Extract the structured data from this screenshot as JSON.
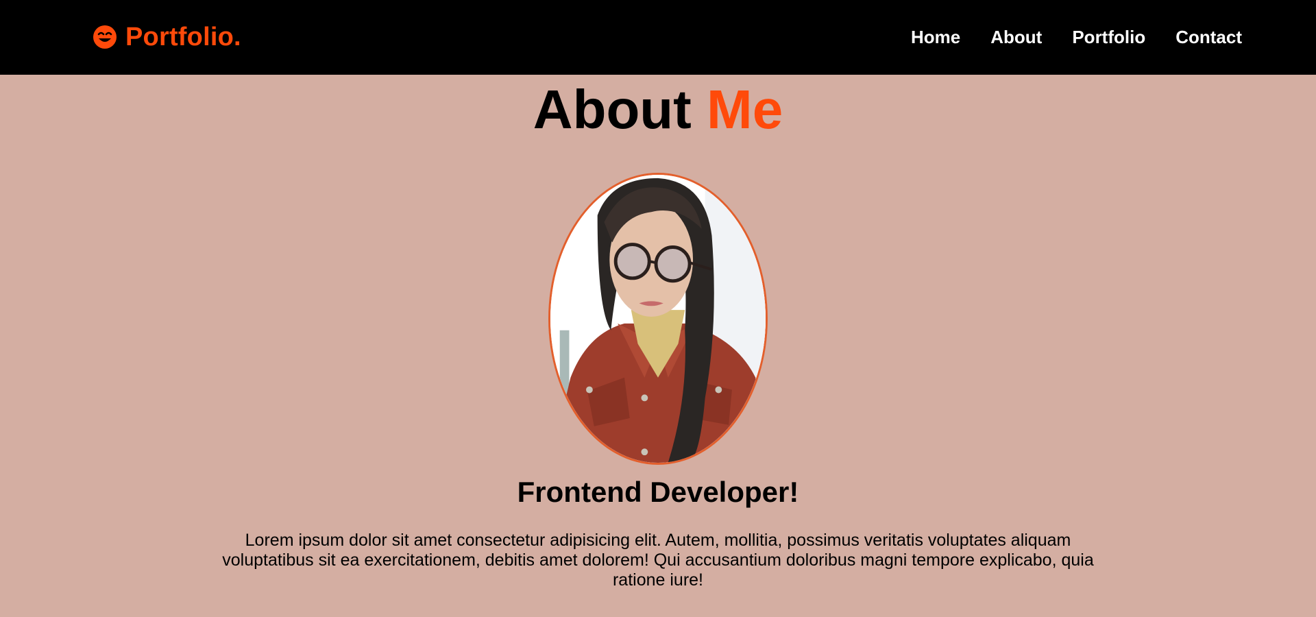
{
  "nav": {
    "brand": {
      "icon": "smiley-face-icon",
      "label": "Portfolio."
    },
    "links": [
      {
        "label": "Home"
      },
      {
        "label": "About"
      },
      {
        "label": "Portfolio"
      },
      {
        "label": "Contact"
      }
    ]
  },
  "about": {
    "title_main": "About",
    "title_accent": "Me",
    "photo": {
      "alt": "profile-photo"
    },
    "role": "Frontend Developer!",
    "bio": "Lorem ipsum dolor sit amet consectetur adipisicing elit. Autem, mollitia, possimus veritatis voluptates aliquam voluptatibus sit ea exercitationem, debitis amet dolorem! Qui accusantium doloribus magni tempore explicabo, quia ratione iure!"
  },
  "colors": {
    "page_background": "#d4aea2",
    "navbar_background": "#000000",
    "accent": "#ff4a0a",
    "photo_border": "#e35f2c",
    "nav_text": "#ffffff"
  }
}
